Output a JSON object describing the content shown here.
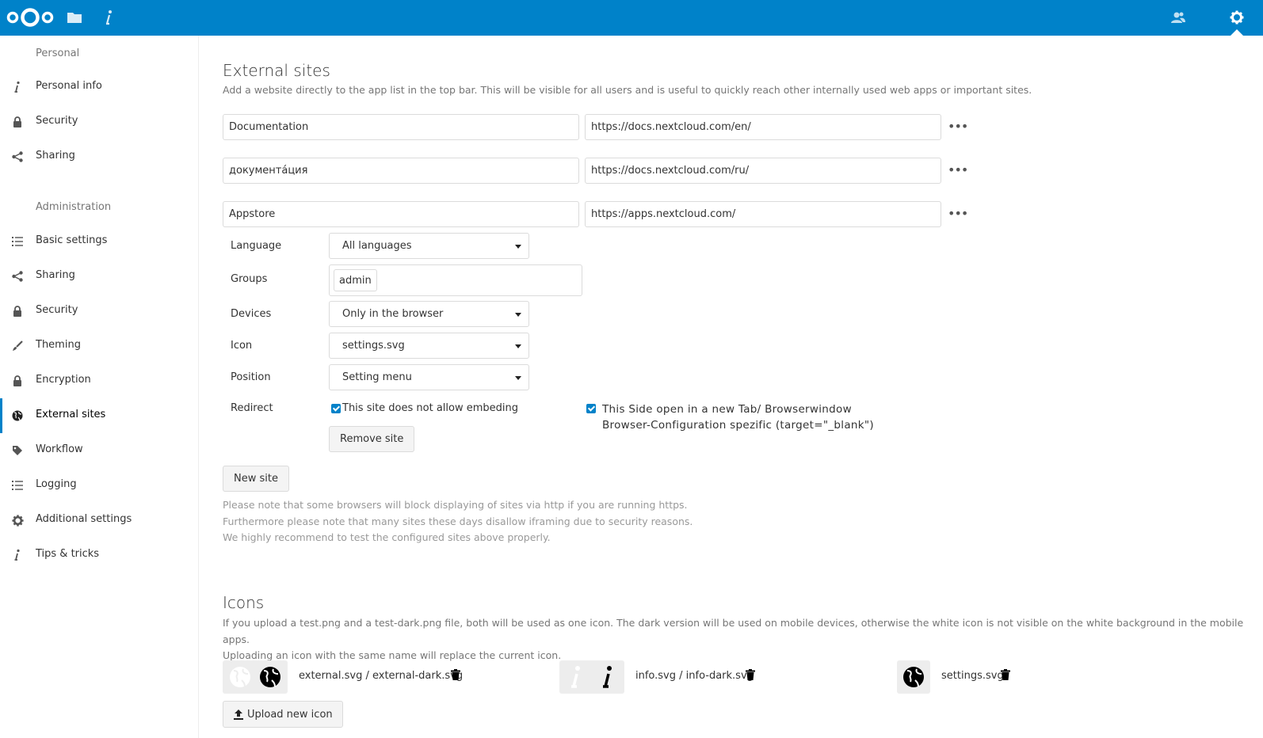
{
  "header": {
    "logo": "nextcloud-logo",
    "apps": [
      {
        "name": "files",
        "icon": "folder-icon"
      },
      {
        "name": "info",
        "icon": "info-icon"
      }
    ],
    "right": [
      {
        "name": "contacts",
        "icon": "contacts-icon"
      },
      {
        "name": "settings",
        "icon": "gear-icon"
      }
    ],
    "accent": "#0082c9"
  },
  "sidebar": {
    "personal_heading": "Personal",
    "personal_items": [
      {
        "label": "Personal info",
        "icon": "info-icon"
      },
      {
        "label": "Security",
        "icon": "lock-icon"
      },
      {
        "label": "Sharing",
        "icon": "share-icon"
      }
    ],
    "admin_heading": "Administration",
    "admin_items": [
      {
        "label": "Basic settings",
        "icon": "list-icon"
      },
      {
        "label": "Sharing",
        "icon": "share-icon"
      },
      {
        "label": "Security",
        "icon": "lock-icon"
      },
      {
        "label": "Theming",
        "icon": "brush-icon"
      },
      {
        "label": "Encryption",
        "icon": "lock-icon"
      },
      {
        "label": "External sites",
        "icon": "globe-icon",
        "active": true
      },
      {
        "label": "Workflow",
        "icon": "tag-icon"
      },
      {
        "label": "Logging",
        "icon": "list-icon"
      },
      {
        "label": "Additional settings",
        "icon": "gear-icon"
      },
      {
        "label": "Tips & tricks",
        "icon": "info-icon"
      }
    ]
  },
  "external_sites": {
    "title": "External sites",
    "description": "Add a website directly to the app list in the top bar. This will be visible for all users and is useful to quickly reach other internally used web apps or important sites.",
    "sites": [
      {
        "name": "Documentation",
        "url": "https://docs.nextcloud.com/en/"
      },
      {
        "name": "документáция",
        "url": "https://docs.nextcloud.com/ru/"
      },
      {
        "name": "Appstore",
        "url": "https://apps.nextcloud.com/"
      }
    ],
    "form": {
      "language_label": "Language",
      "language_value": "All languages",
      "groups_label": "Groups",
      "groups_tag": "admin",
      "devices_label": "Devices",
      "devices_value": "Only in the browser",
      "icon_label": "Icon",
      "icon_value": "settings.svg",
      "position_label": "Position",
      "position_value": "Setting menu",
      "redirect_label": "Redirect",
      "redirect_checkbox_label": "This site does not allow embeding",
      "newtab_checkbox_label_line1": "This Side open in a new Tab/ Browserwindow",
      "newtab_checkbox_label_line2": "Browser-Configuration spezific (target=\"_blank\")",
      "remove_button": "Remove site"
    },
    "new_site_button": "New site",
    "notes": [
      "Please note that some browsers will block displaying of sites via http if you are running https.",
      "Furthermore please note that many sites these days disallow iframing due to security reasons.",
      "We highly recommend to test the configured sites above properly."
    ]
  },
  "icons": {
    "title": "Icons",
    "description_line1": "If you upload a test.png and a test-dark.png file, both will be used as one icon. The dark version will be used on mobile devices, otherwise the white icon is not visible on the white background in the mobile apps.",
    "description_line2": "Uploading an icon with the same name will replace the current icon.",
    "items": [
      {
        "name": "external.svg / external-dark.svg",
        "icon": "globe-icon"
      },
      {
        "name": "info.svg / info-dark.svg",
        "icon": "info-icon"
      },
      {
        "name": "settings.svg",
        "icon": "globe-icon"
      }
    ],
    "upload_button": "Upload new icon"
  }
}
